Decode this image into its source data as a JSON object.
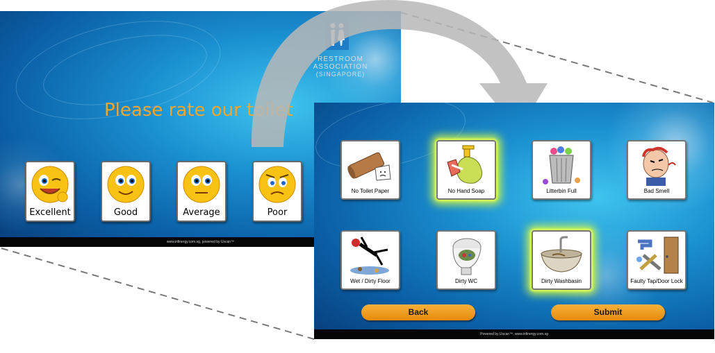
{
  "screen1": {
    "title": "Please rate our toilet",
    "ratings": [
      {
        "label": "Excellent",
        "icon": "excellent-smiley-icon"
      },
      {
        "label": "Good",
        "icon": "good-smiley-icon"
      },
      {
        "label": "Average",
        "icon": "average-smiley-icon"
      },
      {
        "label": "Poor",
        "icon": "poor-smiley-icon"
      }
    ],
    "footer": "www.infinergy.com.sg, powered by Uscan™"
  },
  "logo": {
    "line1": "RESTROOM",
    "line2": "ASSOCIATION",
    "line3": "(SINGAPORE)"
  },
  "screen2": {
    "issues": [
      {
        "label": "No Toilet Paper",
        "icon": "toilet-paper-icon",
        "highlighted": false
      },
      {
        "label": "No Hand Soap",
        "icon": "hand-soap-icon",
        "highlighted": true
      },
      {
        "label": "Litterbin Full",
        "icon": "litterbin-icon",
        "highlighted": false
      },
      {
        "label": "Bad Smell",
        "icon": "bad-smell-icon",
        "highlighted": false
      },
      {
        "label": "Wet / Dirty Floor",
        "icon": "wet-floor-icon",
        "highlighted": false
      },
      {
        "label": "Dirty WC",
        "icon": "dirty-wc-icon",
        "highlighted": false
      },
      {
        "label": "Dirty Washbasin",
        "icon": "washbasin-icon",
        "highlighted": true
      },
      {
        "label": "Faulty Tap/Door Lock",
        "icon": "faulty-tap-icon",
        "highlighted": false
      }
    ],
    "back_label": "Back",
    "submit_label": "Submit",
    "footer": "Powered by Uscan™, www.infinergy.com.sg"
  },
  "colors": {
    "accent_orange": "#f3a52c",
    "button_orange": "#f2a12a",
    "highlight_glow": "#deff3c",
    "screen_blue": "#1a8fd0"
  }
}
